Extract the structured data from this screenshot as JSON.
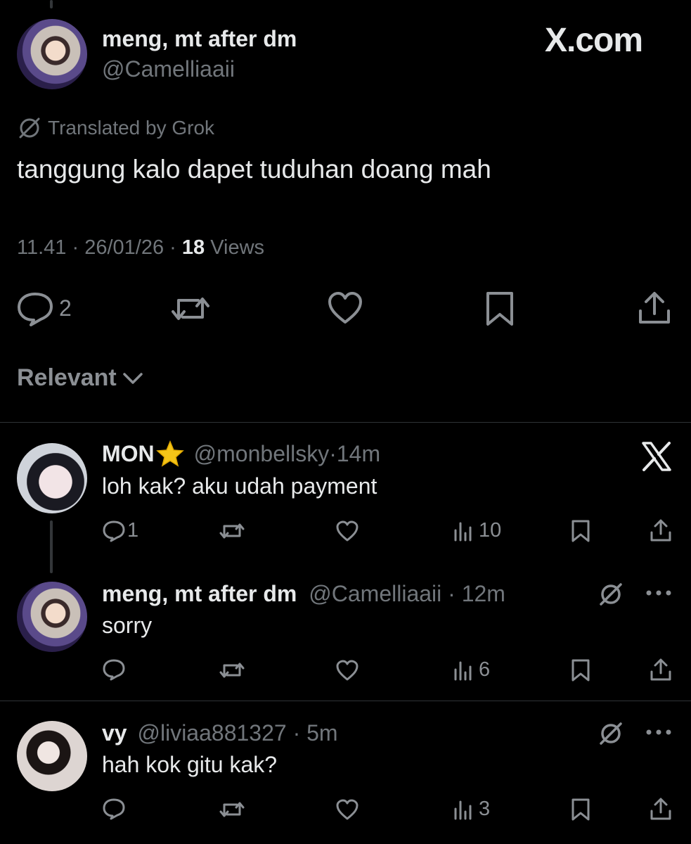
{
  "watermark": "X.com",
  "main_post": {
    "display_name": "meng, mt after dm",
    "handle": "@Camelliaaii",
    "translated_label": "Translated by Grok",
    "text": "tanggung kalo dapet tuduhan doang mah",
    "time": "11.41",
    "date": "26/01/26",
    "views_count": "18",
    "views_label": "Views",
    "reply_count": "2"
  },
  "sort": {
    "label": "Relevant"
  },
  "replies": [
    {
      "display_name": "MON",
      "handle": "@monbellsky",
      "age": "14m",
      "text": "loh kak? aku udah payment",
      "reply_count": "1",
      "views": "10"
    },
    {
      "display_name": "meng, mt after dm",
      "handle": "@Camelliaaii",
      "age": "12m",
      "text": "sorry",
      "reply_count": "",
      "views": "6"
    },
    {
      "display_name": "vy",
      "handle": "@liviaa881327",
      "age": "5m",
      "text": "hah kok gitu kak?",
      "reply_count": "",
      "views": "3"
    }
  ],
  "sep": " · ",
  "icons": {
    "reply": "reply-icon",
    "repost": "repost-icon",
    "like": "like-icon",
    "views": "views-icon",
    "bookmark": "bookmark-icon",
    "share": "share-icon",
    "translate": "translate-icon",
    "more": "more-icon",
    "x_logo": "x-logo-icon",
    "star": "star-icon",
    "chevron": "chevron-down-icon"
  },
  "colors": {
    "background": "#000000",
    "text": "#e7e9ea",
    "muted": "#71767b",
    "star": "#f5c518"
  }
}
